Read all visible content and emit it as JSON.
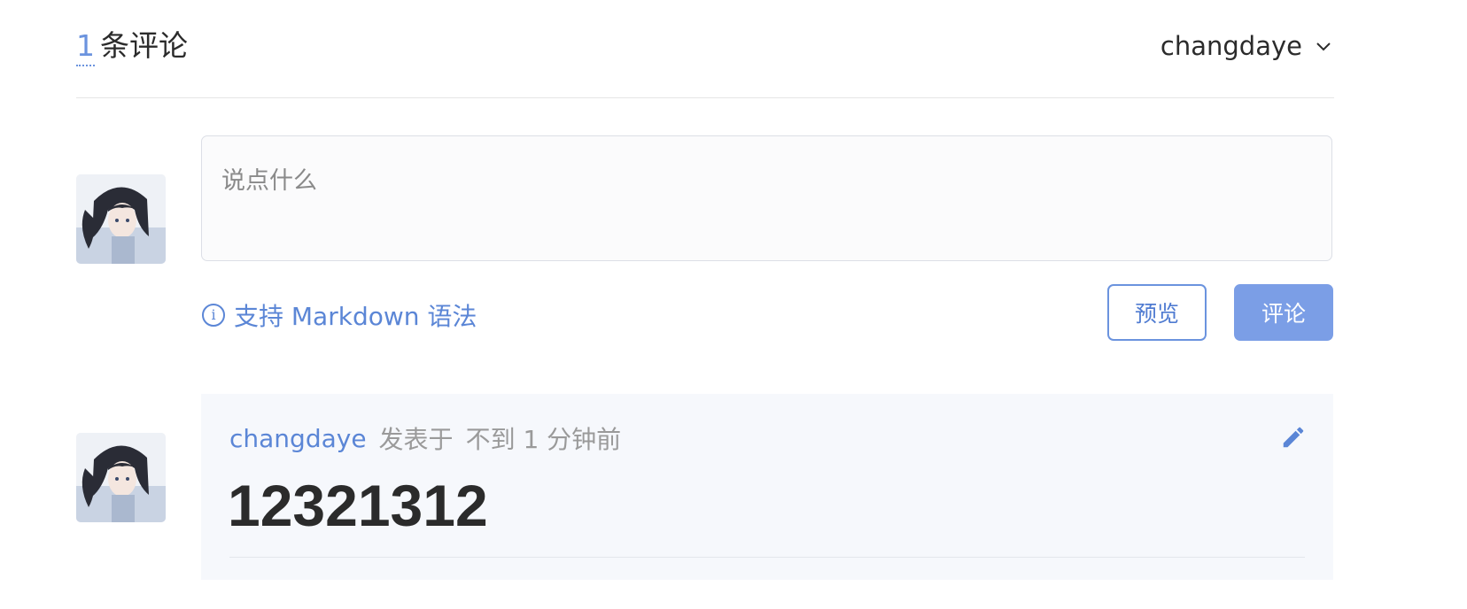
{
  "header": {
    "comment_count": "1",
    "comment_count_suffix": "条评论",
    "current_user": "changdaye"
  },
  "editor": {
    "placeholder": "说点什么",
    "value": "",
    "markdown_hint": "支持 Markdown 语法",
    "preview_label": "预览",
    "submit_label": "评论"
  },
  "comments": [
    {
      "author": "changdaye",
      "posted_label": "发表于",
      "time": "不到 1 分钟前",
      "body": "12321312"
    }
  ],
  "colors": {
    "accent": "#6b93de",
    "submit_bg": "#7b9ee6",
    "card_bg": "#f6f8fc",
    "muted_text": "#9a9a9a"
  },
  "icons": {
    "dropdown": "chevron-down-icon",
    "info": "info-icon",
    "edit": "pencil-icon"
  }
}
